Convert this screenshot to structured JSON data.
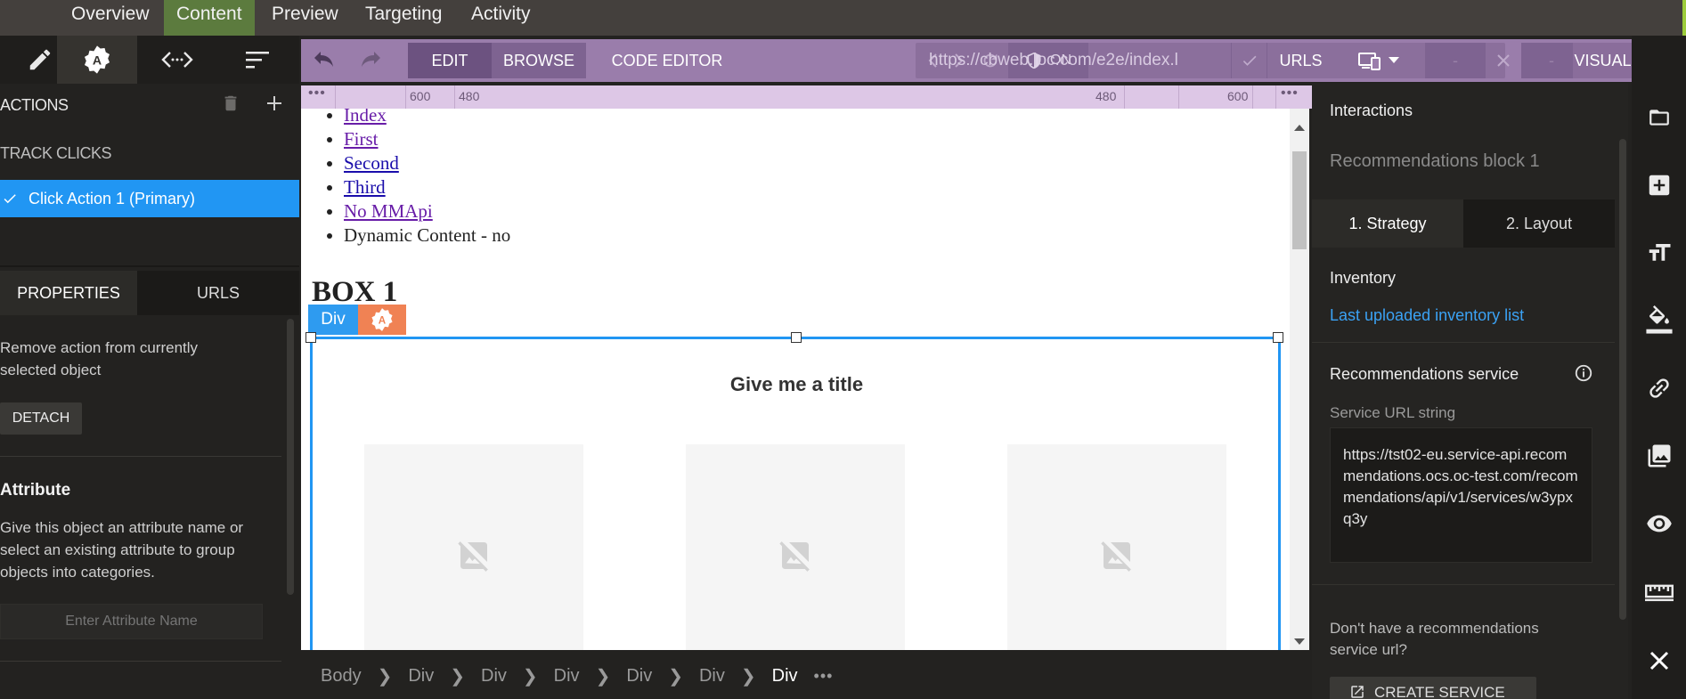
{
  "top_nav": {
    "tabs": [
      {
        "label": "Overview",
        "active": false
      },
      {
        "label": "Content",
        "active": true
      },
      {
        "label": "Preview",
        "active": false
      },
      {
        "label": "Targeting",
        "active": false
      },
      {
        "label": "Activity",
        "active": false
      }
    ]
  },
  "left_tools": [
    "pencil-icon",
    "action-badge-icon",
    "code-icon",
    "sort-icon"
  ],
  "left_panel": {
    "actions_title": "ACTIONS",
    "track_clicks_title": "TRACK CLICKS",
    "click_action_label": "Click Action 1 (Primary)",
    "tabs": {
      "properties": "PROPERTIES",
      "urls": "URLS"
    },
    "remove_text": "Remove action from currently selected object",
    "detach_label": "DETACH",
    "attribute_title": "Attribute",
    "attribute_desc": "Give this object an attribute name or select an existing attribute to group objects into categories.",
    "attribute_placeholder": "Enter Attribute Name"
  },
  "editor_toolbar": {
    "edit_label": "EDIT",
    "browse_label": "BROWSE",
    "code_editor_label": "CODE EDITOR",
    "on_label": "ON",
    "url": "https://cbweb.loc.com/e2e/index.l",
    "urls_label": "URLS",
    "dash1": "-",
    "dash2": "-",
    "visual_label": "VISUAL"
  },
  "ruler": {
    "left_600": "600",
    "left_480": "480",
    "right_480": "480",
    "right_600": "600"
  },
  "canvas": {
    "links": [
      {
        "text": "Index",
        "visited": true
      },
      {
        "text": "First",
        "visited": true
      },
      {
        "text": "Second",
        "visited": false
      },
      {
        "text": "Third",
        "visited": false
      },
      {
        "text": "No MMApi",
        "visited": true
      }
    ],
    "dynamic_text": "Dynamic Content - no",
    "box_heading": "BOX 1",
    "div_tag": "Div",
    "rec_title": "Give me a title"
  },
  "breadcrumb": [
    "Body",
    "Div",
    "Div",
    "Div",
    "Div",
    "Div",
    "Div"
  ],
  "right_panel": {
    "title": "Interactions",
    "block_name": "Recommendations block 1",
    "tab_strategy": "1. Strategy",
    "tab_layout": "2. Layout",
    "inventory_label": "Inventory",
    "inventory_link": "Last uploaded inventory list",
    "rec_service_label": "Recommendations service",
    "service_url_label": "Service URL string",
    "service_url": "https://tst02-eu.service-api.recommendations.ocs.oc-test.com/recommendations/api/v1/services/w3ypxq3y",
    "question": "Don't have a recommendations service url?",
    "create_label": "CREATE SERVICE"
  },
  "colors": {
    "toolbar_purple": "#9a7dab",
    "selection_blue": "#2196f3",
    "active_tab_green": "#5c7b3e",
    "badge_orange": "#f08254"
  }
}
